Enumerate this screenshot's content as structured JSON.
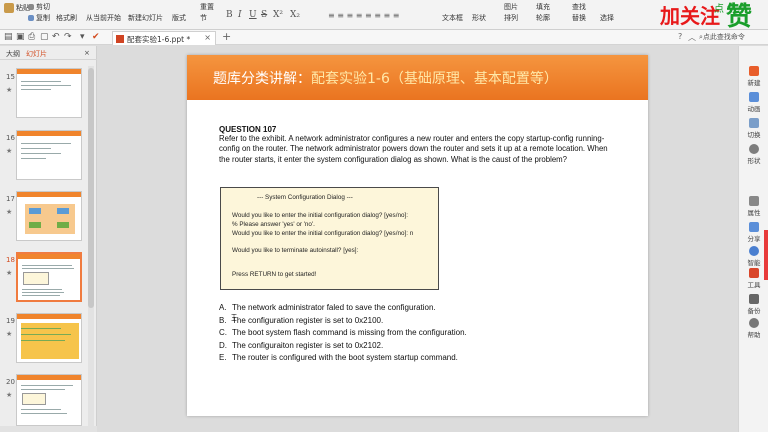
{
  "ribbon": {
    "paste": "粘贴",
    "copy": "复制",
    "format_painter": "格式刷",
    "cut": "剪切",
    "from_current": "从当前开始",
    "new_slide": "新建幻灯片",
    "layout": "版式",
    "reset": "重置",
    "section": "节",
    "textbox": "文本框",
    "shape": "形状",
    "arrange": "排列",
    "outline": "轮廓",
    "replace": "替换",
    "select": "选择",
    "picture": "图片",
    "fill": "填充",
    "find": "查找",
    "format_glyphs": [
      "B",
      "I",
      "U",
      "S",
      "X²",
      "X₂"
    ],
    "promo_text": "加关注",
    "promo_big": "赞",
    "promo_small": "点"
  },
  "tabbar": {
    "doc_tab": "配套实验1-6.ppt *",
    "new_tab": "+",
    "search_command": "点此查找命令"
  },
  "left_panel": {
    "tab_outline": "大纲",
    "tab_slides": "幻灯片",
    "slides": [
      {
        "num": "15"
      },
      {
        "num": "16"
      },
      {
        "num": "17"
      },
      {
        "num": "18"
      },
      {
        "num": "19"
      },
      {
        "num": "20"
      }
    ]
  },
  "slide": {
    "title_prefix": "题库分类讲解：",
    "title_accent": "配套实验1-6（基础原理、基本配置等）",
    "question_head": "QUESTION 107",
    "question_body": "Refer to the exhibit. A network administrator configures a new router and enters the copy startup-config running-config on the router. The network administrator powers down the router and sets it up at a remote location. When the router starts, it enter the system configuration dialog as shown. What is the caust of the problem?",
    "exhibit": {
      "line1": "--- System Configuration Dialog ---",
      "line2": "Would you like to enter the initial configuration dialog? [yes/no]:",
      "line3": "% Please answer 'yes' or 'no'.",
      "line4": "Would you like to enter the initial configuration dialog? [yes/no]: n",
      "line5": "Would you like to terminate autoinstall? [yes]:",
      "line6": "Press RETURN to get started!"
    },
    "answers": [
      {
        "letter": "A.",
        "text": "The network administrator faled to save the configuration."
      },
      {
        "letter": "B.",
        "text": "The configuration register is set to 0x2100."
      },
      {
        "letter": "C.",
        "text": "The boot system flash command is missing from the configuration."
      },
      {
        "letter": "D.",
        "text": "The configuraiton register is set to 0x2102."
      },
      {
        "letter": "E.",
        "text": "The router is configured with the boot system startup command."
      }
    ]
  },
  "right_panel": {
    "items": [
      "新建",
      "动画",
      "切换",
      "形状",
      "属性",
      "分享",
      "智能",
      "工具",
      "备份",
      "帮助"
    ]
  },
  "colors": {
    "slide_header": "#ea7420",
    "accent_text": "#ffe8a8",
    "exhibit_bg": "#fdf6da",
    "active_tab": "#d24a1e",
    "promo_red": "#e8191a",
    "promo_green": "#1a9e2b"
  }
}
